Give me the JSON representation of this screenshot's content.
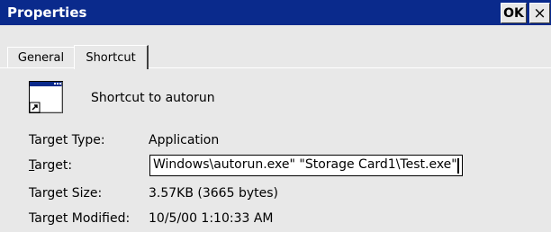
{
  "window": {
    "title": "Properties",
    "ok_label": "OK",
    "close_label": "×"
  },
  "tabs": [
    {
      "label": "General",
      "selected": false
    },
    {
      "label": "Shortcut",
      "selected": true
    }
  ],
  "shortcut": {
    "icon": "application-shortcut-icon",
    "name": "Shortcut to autorun"
  },
  "fields": {
    "target_type_label": "Target Type:",
    "target_type_value": "Application",
    "target_label": "Target:",
    "target_value": "Windows\\autorun.exe\" \"Storage Card1\\Test.exe\"",
    "target_size_label": "Target Size:",
    "target_size_value": "3.57KB (3665 bytes)",
    "target_modified_label": "Target Modified:",
    "target_modified_value": "10/5/00 1:10:33 AM"
  },
  "colors": {
    "titlebar": "#0a2a8c",
    "window_bg": "#e8e8e8"
  }
}
